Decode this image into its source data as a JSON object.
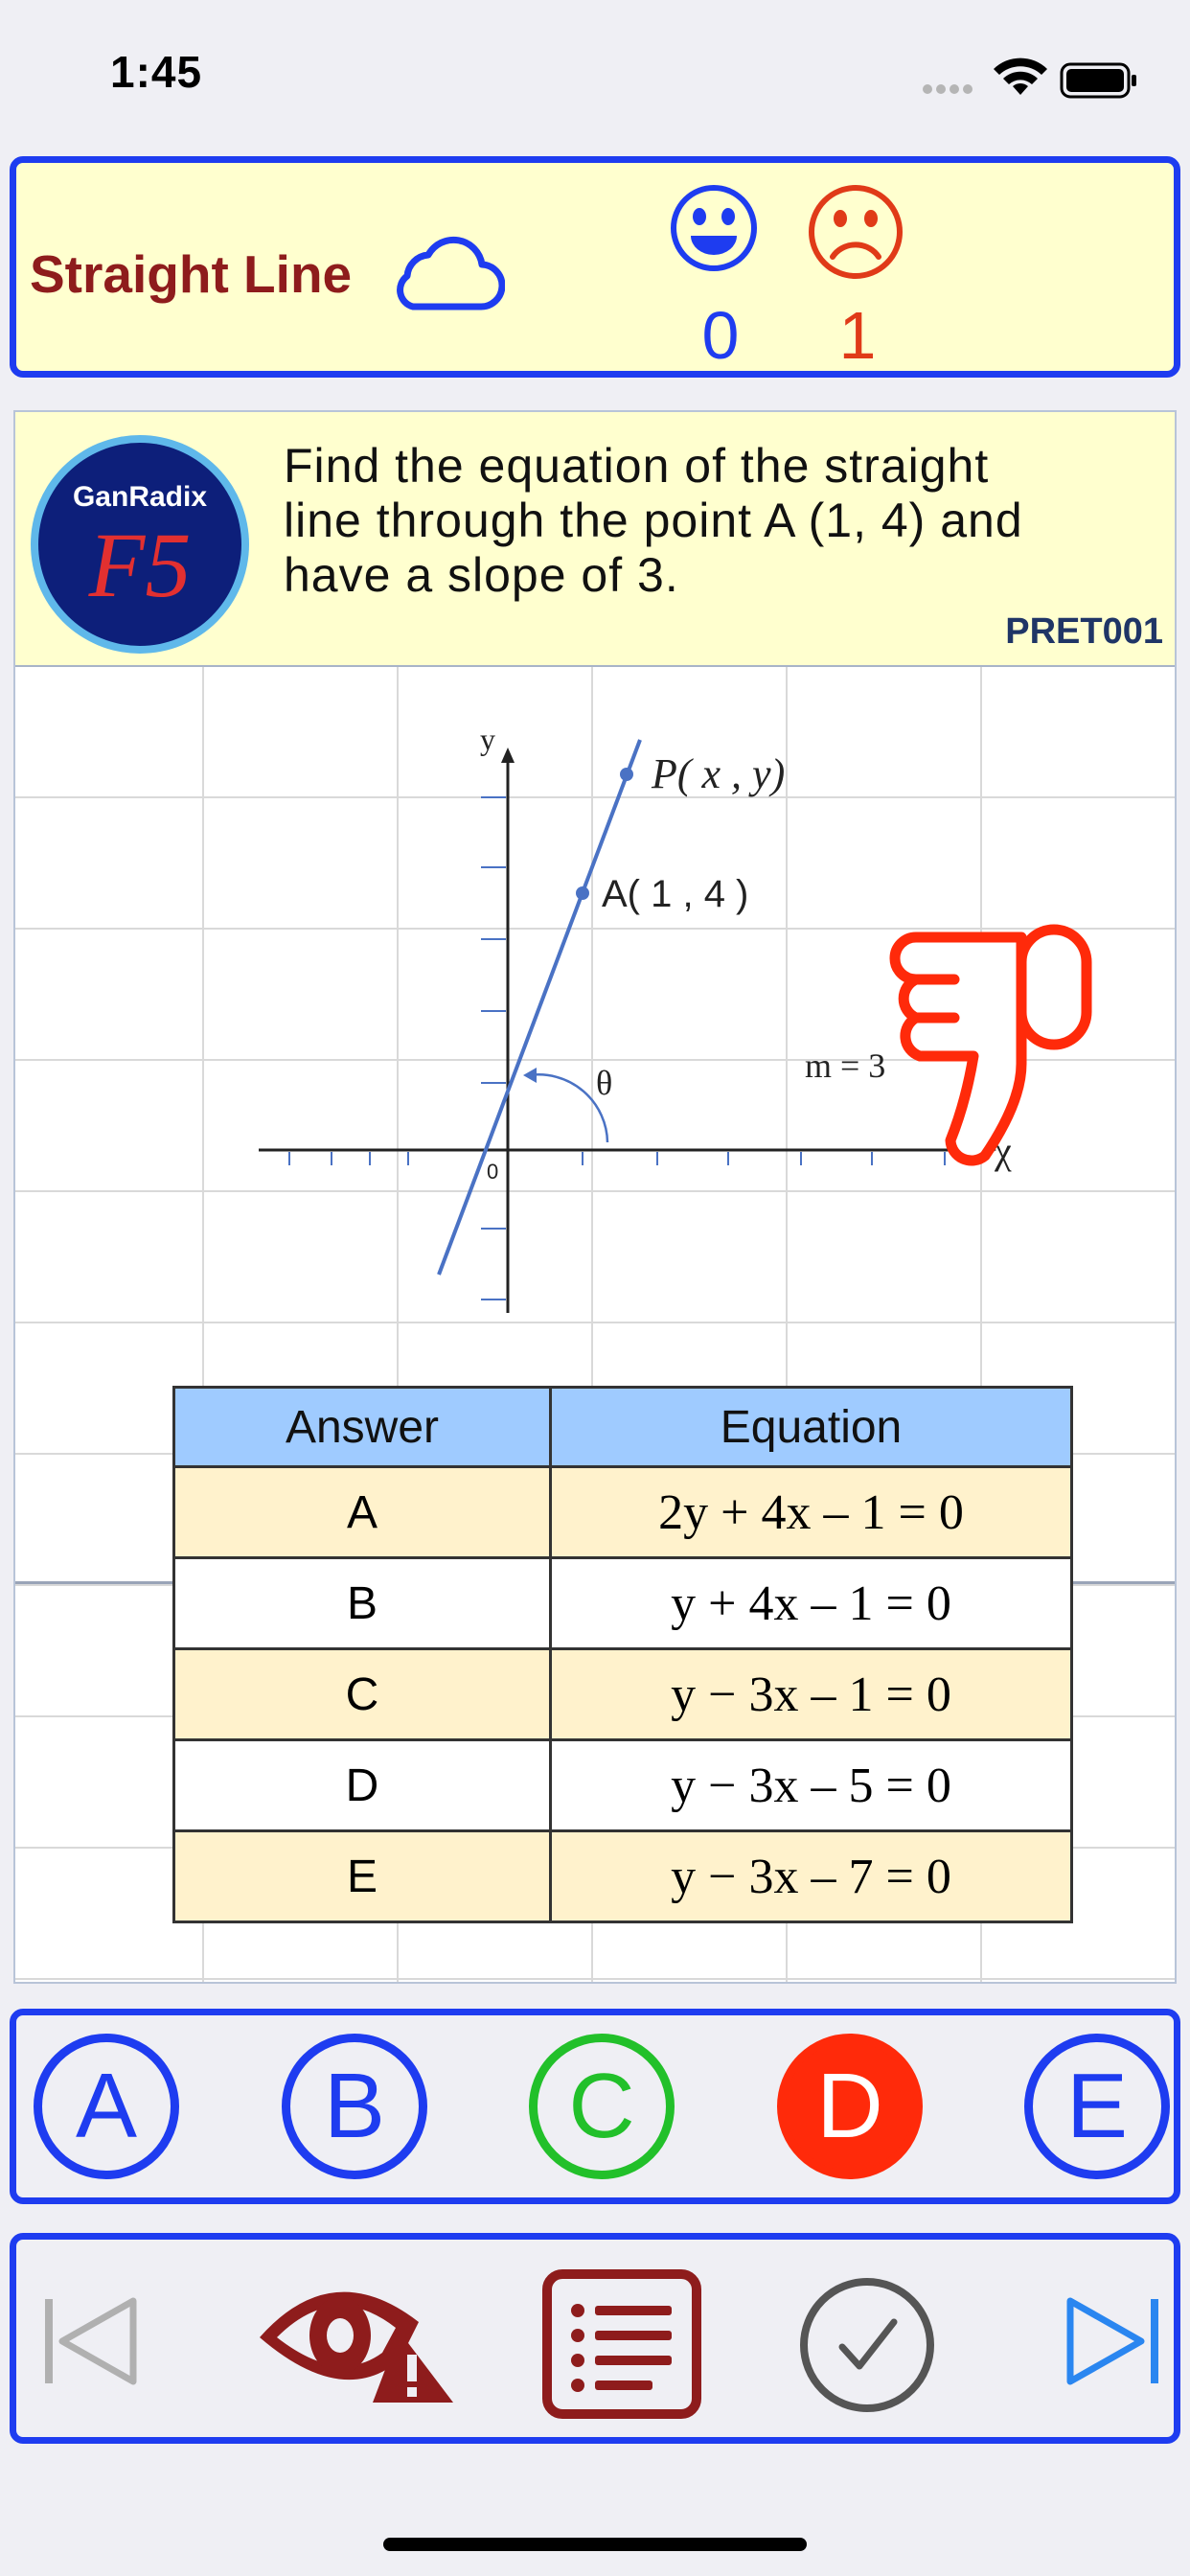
{
  "status_bar": {
    "time": "1:45",
    "icons": [
      "signal-dots-icon",
      "wifi-icon",
      "battery-icon"
    ]
  },
  "header": {
    "title": "Straight Line",
    "cloud_icon": "cloud-icon",
    "score": {
      "correct": "0",
      "wrong": "1"
    },
    "colors": {
      "title": "#8e1c1c",
      "correct": "#1e3cf0",
      "wrong": "#e03a18"
    }
  },
  "question": {
    "logo": {
      "brand": "GanRadix",
      "mark": "F5"
    },
    "text_lines": [
      "Find the equation of the straight",
      "line through the point A (1, 4) and",
      "have a slope of 3."
    ],
    "code": "PRET001",
    "graph": {
      "y_label": "y",
      "x_label": "χ",
      "origin_label": "0",
      "point_p": "P( x , y)",
      "point_a": "A( 1 , 4 )",
      "slope_label": "m = 3",
      "angle_label": "θ"
    },
    "feedback_icon": "thumbs-down-icon"
  },
  "answer_table": {
    "headers": [
      "Answer",
      "Equation"
    ],
    "rows": [
      {
        "answer": "A",
        "equation": "2y + 4x – 1 = 0"
      },
      {
        "answer": "B",
        "equation": "y + 4x – 1 = 0"
      },
      {
        "answer": "C",
        "equation": "y − 3x – 1 = 0"
      },
      {
        "answer": "D",
        "equation": "y − 3x – 5 = 0"
      },
      {
        "answer": "E",
        "equation": "y − 3x – 7 = 0"
      }
    ]
  },
  "choices": {
    "options": [
      "A",
      "B",
      "C",
      "D",
      "E"
    ],
    "correct": "C",
    "selected": "D",
    "colors": {
      "default": "#1e3cf0",
      "correct": "#22c02a",
      "selected": "#ff2a0a"
    }
  },
  "toolbar": {
    "items": [
      "previous-icon",
      "hide-hint-icon",
      "list-icon",
      "check-icon",
      "next-icon"
    ]
  }
}
